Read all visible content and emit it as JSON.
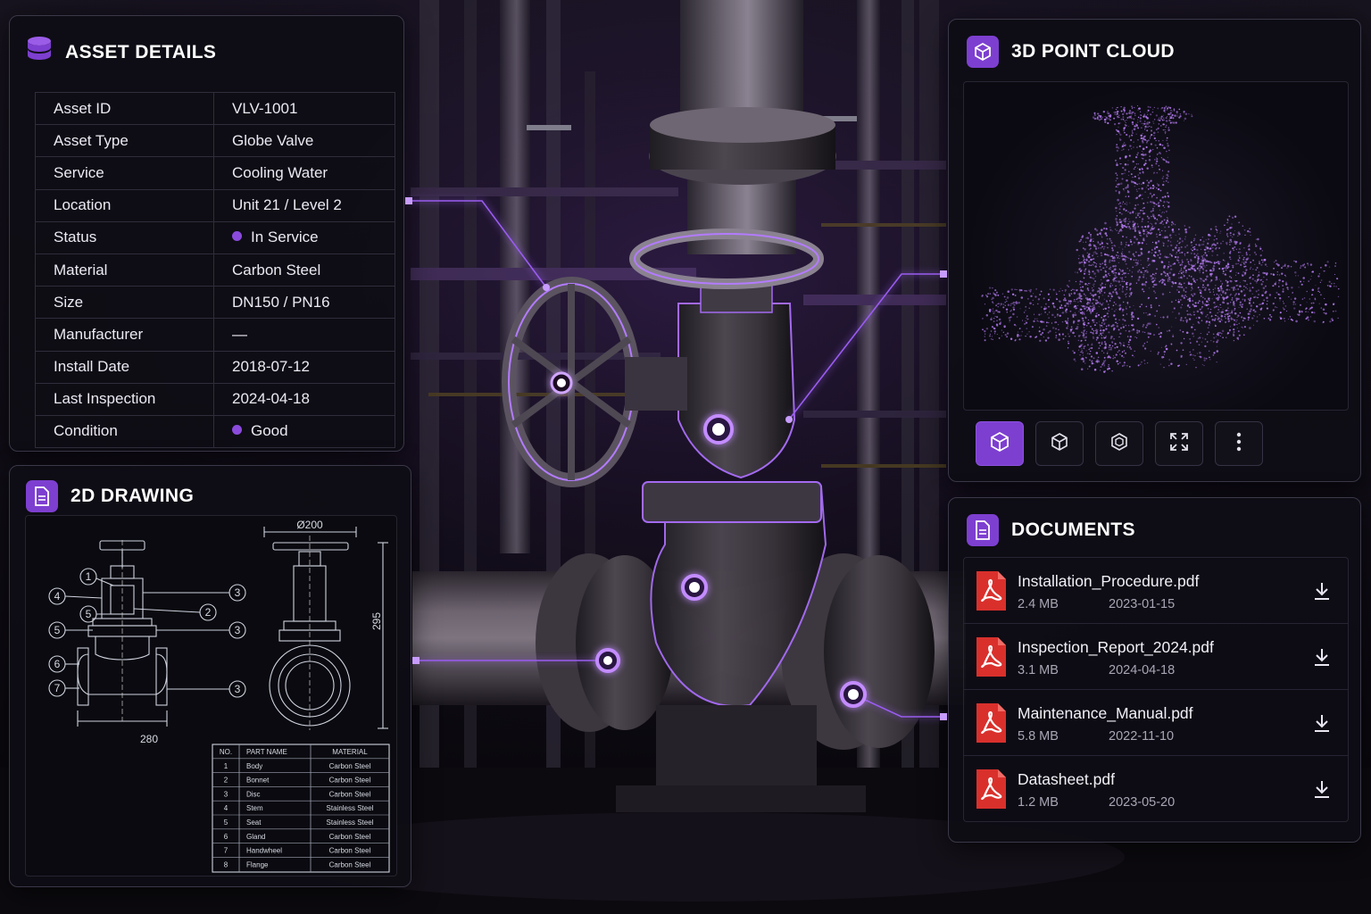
{
  "asset_details": {
    "title": "ASSET DETAILS",
    "icon": "database-icon",
    "rows": [
      {
        "label": "Asset ID",
        "value": "VLV-1001"
      },
      {
        "label": "Asset Type",
        "value": "Globe Valve"
      },
      {
        "label": "Service",
        "value": "Cooling Water"
      },
      {
        "label": "Location",
        "value": "Unit 21 / Level 2"
      },
      {
        "label": "Status",
        "value": "In Service"
      },
      {
        "label": "Material",
        "value": "Carbon Steel"
      },
      {
        "label": "Size",
        "value": "DN150 / PN16"
      },
      {
        "label": "Manufacturer",
        "value": "—"
      },
      {
        "label": "Install Date",
        "value": "2018-07-12"
      },
      {
        "label": "Last Inspection",
        "value": "2024-04-18"
      },
      {
        "label": "Condition",
        "value": "Good"
      }
    ]
  },
  "drawing": {
    "title": "2D DRAWING",
    "icon": "document-icon",
    "dim_width": "Ø200",
    "dim_height": "295",
    "dim_base": "280",
    "callouts": [
      "1",
      "4",
      "5",
      "5",
      "6",
      "7",
      "3",
      "2",
      "3",
      "3"
    ],
    "parts_table": {
      "headers": [
        "NO.",
        "PART NAME",
        "MATERIAL"
      ],
      "rows": [
        [
          "1",
          "Body",
          "Carbon Steel"
        ],
        [
          "2",
          "Bonnet",
          "Carbon Steel"
        ],
        [
          "3",
          "Disc",
          "Carbon Steel"
        ],
        [
          "4",
          "Stem",
          "Stainless Steel"
        ],
        [
          "5",
          "Seat",
          "Stainless Steel"
        ],
        [
          "6",
          "Gland",
          "Carbon Steel"
        ],
        [
          "7",
          "Handwheel",
          "Carbon Steel"
        ],
        [
          "8",
          "Flange",
          "Carbon Steel"
        ]
      ]
    }
  },
  "point_cloud": {
    "title": "3D POINT CLOUD",
    "icon": "cube-icon",
    "toolbar": [
      "cube-solid-icon",
      "cube-outline-icon",
      "cube-iso-icon",
      "fullscreen-icon",
      "more-vertical-icon"
    ]
  },
  "documents": {
    "title": "DOCUMENTS",
    "icon": "file-icon",
    "items": [
      {
        "name": "Installation_Procedure.pdf",
        "size": "2.4 MB",
        "date": "2023-01-15"
      },
      {
        "name": "Inspection_Report_2024.pdf",
        "size": "3.1 MB",
        "date": "2024-04-18"
      },
      {
        "name": "Maintenance_Manual.pdf",
        "size": "5.8 MB",
        "date": "2022-11-10"
      },
      {
        "name": "Datasheet.pdf",
        "size": "1.2 MB",
        "date": "2023-05-20"
      }
    ]
  },
  "colors": {
    "accent": "#7d3fd0",
    "glow": "#a870ff",
    "panel_bg": "#0e0d14",
    "pdf_red": "#d9302c"
  }
}
